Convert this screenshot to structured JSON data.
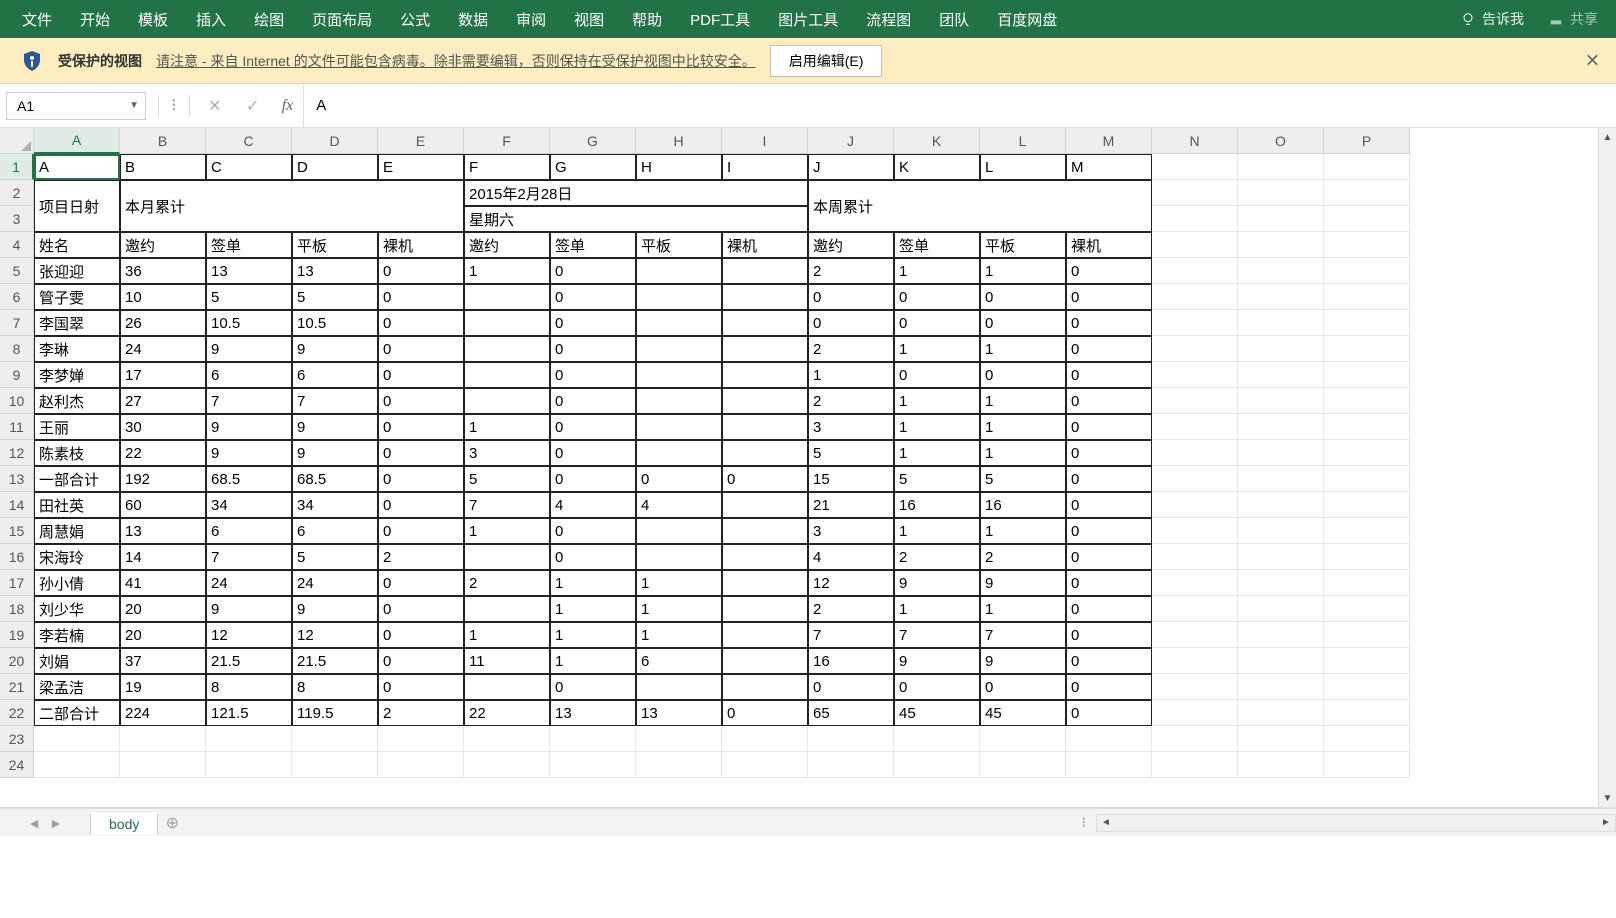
{
  "ribbon": {
    "tabs": [
      "文件",
      "开始",
      "模板",
      "插入",
      "绘图",
      "页面布局",
      "公式",
      "数据",
      "审阅",
      "视图",
      "帮助",
      "PDF工具",
      "图片工具",
      "流程图",
      "团队",
      "百度网盘"
    ],
    "tell_me": "告诉我",
    "share": "共享"
  },
  "protected": {
    "title": "受保护的视图",
    "message": "请注意 - 来自 Internet 的文件可能包含病毒。除非需要编辑，否则保持在受保护视图中比较安全。",
    "enable": "启用编辑(E)"
  },
  "formula": {
    "name_box": "A1",
    "value": "A"
  },
  "columns": [
    "A",
    "B",
    "C",
    "D",
    "E",
    "F",
    "G",
    "H",
    "I",
    "J",
    "K",
    "L",
    "M",
    "N",
    "O",
    "P"
  ],
  "row_count": 24,
  "data": {
    "1": [
      "A",
      "B",
      "C",
      "D",
      "E",
      "F",
      "G",
      "H",
      "I",
      "J",
      "K",
      "L",
      "M"
    ],
    "2": [
      "项目日射",
      "本月累计",
      "",
      "",
      "",
      "2015年2月28日",
      "",
      "",
      "",
      "本周累计",
      "",
      "",
      ""
    ],
    "3": [
      "",
      "",
      "",
      "",
      "",
      "星期六",
      "",
      "",
      "",
      "",
      "",
      "",
      ""
    ],
    "4": [
      "姓名",
      "邀约",
      "签单",
      "平板",
      "裸机",
      "邀约",
      "签单",
      "平板",
      "裸机",
      "邀约",
      "签单",
      "平板",
      "裸机"
    ],
    "5": [
      "张迎迎",
      "36",
      "13",
      "13",
      "0",
      "1",
      "0",
      "",
      "",
      "2",
      "1",
      "1",
      "0"
    ],
    "6": [
      "管子雯",
      "10",
      "5",
      "5",
      "0",
      "",
      "0",
      "",
      "",
      "0",
      "0",
      "0",
      "0"
    ],
    "7": [
      "李国翠",
      "26",
      "10.5",
      "10.5",
      "0",
      "",
      "0",
      "",
      "",
      "0",
      "0",
      "0",
      "0"
    ],
    "8": [
      "李琳",
      "24",
      "9",
      "9",
      "0",
      "",
      "0",
      "",
      "",
      "2",
      "1",
      "1",
      "0"
    ],
    "9": [
      "李梦婵",
      "17",
      "6",
      "6",
      "0",
      "",
      "0",
      "",
      "",
      "1",
      "0",
      "0",
      "0"
    ],
    "10": [
      "赵利杰",
      "27",
      "7",
      "7",
      "0",
      "",
      "0",
      "",
      "",
      "2",
      "1",
      "1",
      "0"
    ],
    "11": [
      "王丽",
      "30",
      "9",
      "9",
      "0",
      "1",
      "0",
      "",
      "",
      "3",
      "1",
      "1",
      "0"
    ],
    "12": [
      "陈素枝",
      "22",
      "9",
      "9",
      "0",
      "3",
      "0",
      "",
      "",
      "5",
      "1",
      "1",
      "0"
    ],
    "13": [
      "一部合计",
      "192",
      "68.5",
      "68.5",
      "0",
      "5",
      "0",
      "0",
      "0",
      "15",
      "5",
      "5",
      "0"
    ],
    "14": [
      "田社英",
      "60",
      "34",
      "34",
      "0",
      "7",
      "4",
      "4",
      "",
      "21",
      "16",
      "16",
      "0"
    ],
    "15": [
      "周慧娟",
      "13",
      "6",
      "6",
      "0",
      "1",
      "0",
      "",
      "",
      "3",
      "1",
      "1",
      "0"
    ],
    "16": [
      "宋海玲",
      "14",
      "7",
      "5",
      "2",
      "",
      "0",
      "",
      "",
      "4",
      "2",
      "2",
      "0"
    ],
    "17": [
      "孙小倩",
      "41",
      "24",
      "24",
      "0",
      "2",
      "1",
      "1",
      "",
      "12",
      "9",
      "9",
      "0"
    ],
    "18": [
      "刘少华",
      "20",
      "9",
      "9",
      "0",
      "",
      "1",
      "1",
      "",
      "2",
      "1",
      "1",
      "0"
    ],
    "19": [
      "李若楠",
      "20",
      "12",
      "12",
      "0",
      "1",
      "1",
      "1",
      "",
      "7",
      "7",
      "7",
      "0"
    ],
    "20": [
      "刘娟",
      "37",
      "21.5",
      "21.5",
      "0",
      "11",
      "1",
      "6",
      "",
      "16",
      "9",
      "9",
      "0"
    ],
    "21": [
      "梁孟洁",
      "19",
      "8",
      "8",
      "0",
      "",
      "0",
      "",
      "",
      "0",
      "0",
      "0",
      "0"
    ],
    "22": [
      "二部合计",
      "224",
      "121.5",
      "119.5",
      "2",
      "22",
      "13",
      "13",
      "0",
      "65",
      "45",
      "45",
      "0"
    ]
  },
  "merges_vertical": {
    "A2": 2,
    "B2": 2,
    "J2": 2
  },
  "merges_horizontal": {
    "B2": 4,
    "F2": 4,
    "F3": 4,
    "J2": 4
  },
  "overflow": {
    "22_2": true
  },
  "sheet_tab": "body"
}
